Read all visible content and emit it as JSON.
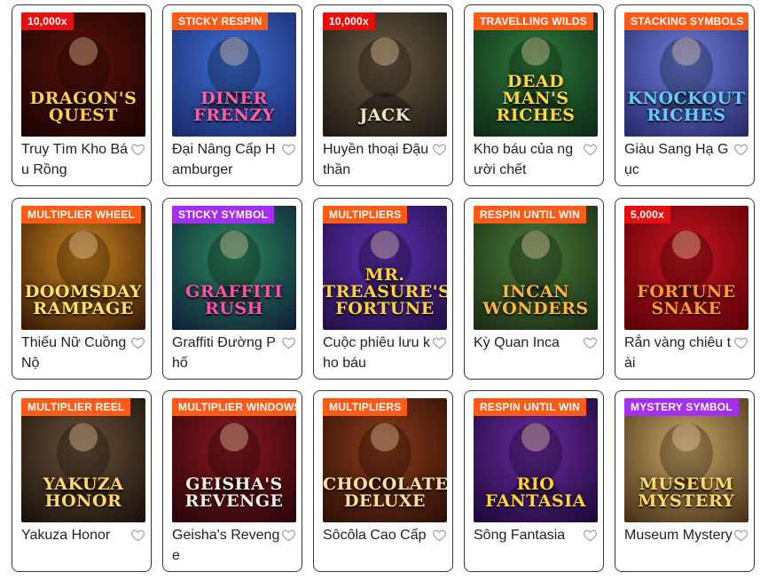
{
  "games": [
    {
      "name": "Truy Tìm Kho Báu Rồng",
      "badge": "10,000x",
      "badge_color": "#e4100f",
      "logo": "DRAGON'S QUEST",
      "bg1": "#5a1208",
      "bg2": "#1a0404",
      "logo_color": "#ffcf4a",
      "icon": "dragon"
    },
    {
      "name": "Đại Nâng Cấp Hamburger",
      "badge": "STICKY RESPIN",
      "badge_color": "#ff5a16",
      "logo": "DINER FRENZY",
      "bg1": "#3d6fd6",
      "bg2": "#1b2a6a",
      "logo_color": "#ff5fa0",
      "icon": "diner"
    },
    {
      "name": "Huyền thoại Đậu thần",
      "badge": "10,000x",
      "badge_color": "#e4100f",
      "logo": "JACK",
      "bg1": "#6a5a44",
      "bg2": "#1e1a14",
      "logo_color": "#efe6c8",
      "icon": "giant"
    },
    {
      "name": "Kho báu của người chết",
      "badge": "TRAVELLING WILDS",
      "badge_color": "#ff5a16",
      "logo": "DEAD MAN'S RICHES",
      "bg1": "#2f7a3a",
      "bg2": "#0e2a18",
      "logo_color": "#ffd640",
      "icon": "skull"
    },
    {
      "name": "Giàu Sang Hạ Gục",
      "badge": "STACKING SYMBOLS",
      "badge_color": "#ff5a16",
      "logo": "KNOCKOUT RICHES",
      "bg1": "#6a7fdc",
      "bg2": "#2a2a6a",
      "logo_color": "#66ccff",
      "icon": "boxer"
    },
    {
      "name": "Thiếu Nữ Cuồng Nộ",
      "badge": "MULTIPLIER WHEEL",
      "badge_color": "#ff5a16",
      "logo": "DOOMSDAY RAMPAGE",
      "bg1": "#c9821e",
      "bg2": "#3a1c06",
      "logo_color": "#ffe26a",
      "icon": "warrior"
    },
    {
      "name": "Graffiti Đường Phố",
      "badge": "STICKY SYMBOL",
      "badge_color": "#a42ff0",
      "logo": "GRAFFITI RUSH",
      "bg1": "#2a8a5a",
      "bg2": "#10203a",
      "logo_color": "#ff4fb0",
      "icon": "graffiti"
    },
    {
      "name": "Cuộc phiêu lưu kho báu",
      "badge": "MULTIPLIERS",
      "badge_color": "#ff5a16",
      "logo": "MR. TREASURE'S FORTUNE",
      "bg1": "#5b2fb0",
      "bg2": "#241048",
      "logo_color": "#ffd23a",
      "icon": "robot"
    },
    {
      "name": "Kỳ Quan Inca",
      "badge": "RESPIN UNTIL WIN",
      "badge_color": "#ff5a16",
      "logo": "INCAN WONDERS",
      "bg1": "#4a7a3a",
      "bg2": "#1a2e14",
      "logo_color": "#ffb43a",
      "icon": "temple"
    },
    {
      "name": "Rắn vàng chiêu tài",
      "badge": "5,000x",
      "badge_color": "#e4100f",
      "logo": "FORTUNE SNAKE",
      "bg1": "#c8141e",
      "bg2": "#5a0208",
      "logo_color": "#ff9a2a",
      "icon": "snake"
    },
    {
      "name": "Yakuza Honor",
      "badge": "MULTIPLIER REEL",
      "badge_color": "#ff5a16",
      "logo": "YAKUZA HONOR",
      "bg1": "#6a5038",
      "bg2": "#1a120c",
      "logo_color": "#ffd86a",
      "icon": "yakuza"
    },
    {
      "name": "Geisha's Revenge",
      "badge": "MULTIPLIER WINDOWS",
      "badge_color": "#ff5a16",
      "logo": "GEISHA'S REVENGE",
      "bg1": "#8a1820",
      "bg2": "#2a060a",
      "logo_color": "#f4efe6",
      "icon": "geisha"
    },
    {
      "name": "Sôcôla Cao Cấp",
      "badge": "MULTIPLIERS",
      "badge_color": "#ff5a16",
      "logo": "CHOCOLATE DELUXE",
      "bg1": "#8a3a1a",
      "bg2": "#2e1006",
      "logo_color": "#ffe0a0",
      "icon": "chocolate"
    },
    {
      "name": "Sông Fantasia",
      "badge": "RESPIN UNTIL WIN",
      "badge_color": "#ff5a16",
      "logo": "RIO FANTASIA",
      "bg1": "#6a2aa0",
      "bg2": "#1e0a3a",
      "logo_color": "#ffd23a",
      "icon": "samba"
    },
    {
      "name": "Museum Mystery",
      "badge": "MYSTERY SYMBOL",
      "badge_color": "#a42ff0",
      "logo": "MUSEUM MYSTERY",
      "bg1": "#caa868",
      "bg2": "#4a3418",
      "logo_color": "#ffd86a",
      "icon": "museum"
    }
  ]
}
